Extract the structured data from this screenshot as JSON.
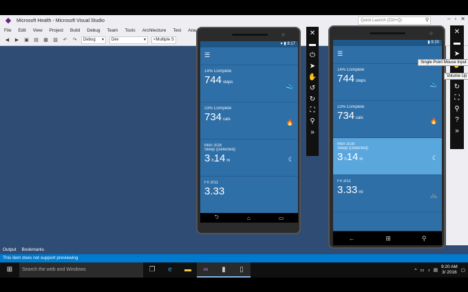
{
  "window": {
    "title": "Microsoft Health - Microsoft Visual Studio",
    "quick_launch_placeholder": "Quick Launch (Ctrl+Q)"
  },
  "menu": [
    "File",
    "Edit",
    "View",
    "Project",
    "Build",
    "Debug",
    "Team",
    "Tools",
    "Architecture",
    "Test",
    "Ana"
  ],
  "toolbar": {
    "config": "Debug",
    "profile": "Dev",
    "platform": "<Multiple S"
  },
  "bottom_tabs": [
    "Output",
    "Bookmarks"
  ],
  "status": "This item does not support previewing",
  "taskbar": {
    "search_placeholder": "Search the web and Windows",
    "time": "9:20 AM",
    "date": "3/",
    "date2": "2016"
  },
  "android": {
    "time": "8:17",
    "tiles": [
      {
        "caption": "14% Complete",
        "value": "744",
        "unit": "steps",
        "icon": "shoe-icon"
      },
      {
        "caption": "23% Complete",
        "value": "734",
        "unit": "cals",
        "icon": "flame-icon"
      },
      {
        "caption": "Mon 3/28",
        "sub": "Sleep (Detected)",
        "value": "3",
        "h": "h",
        "value2": "14",
        "m": "m",
        "icon": "moon-icon"
      },
      {
        "caption": "Fri 3/11",
        "value": "3.33",
        "unit": "",
        "icon": "bike-icon"
      }
    ]
  },
  "winphone": {
    "time": "9:20",
    "tiles": [
      {
        "caption": "14% Complete",
        "value": "744",
        "unit": "steps",
        "icon": "shoe-icon"
      },
      {
        "caption": "23% Complete",
        "value": "734",
        "unit": "cals",
        "icon": "flame-icon"
      },
      {
        "caption": "Mon 3/28",
        "sub": "Sleep (Detected)",
        "value": "3",
        "h": "h",
        "value2": "14",
        "m": "m",
        "icon": "moon-icon"
      },
      {
        "caption": "Fri 3/11",
        "value": "3.33",
        "unit": "mi",
        "icon": "bike-icon"
      }
    ]
  },
  "tooltips": {
    "single_point": "Single Point Mouse Input",
    "volume_up": "Volume Up"
  }
}
